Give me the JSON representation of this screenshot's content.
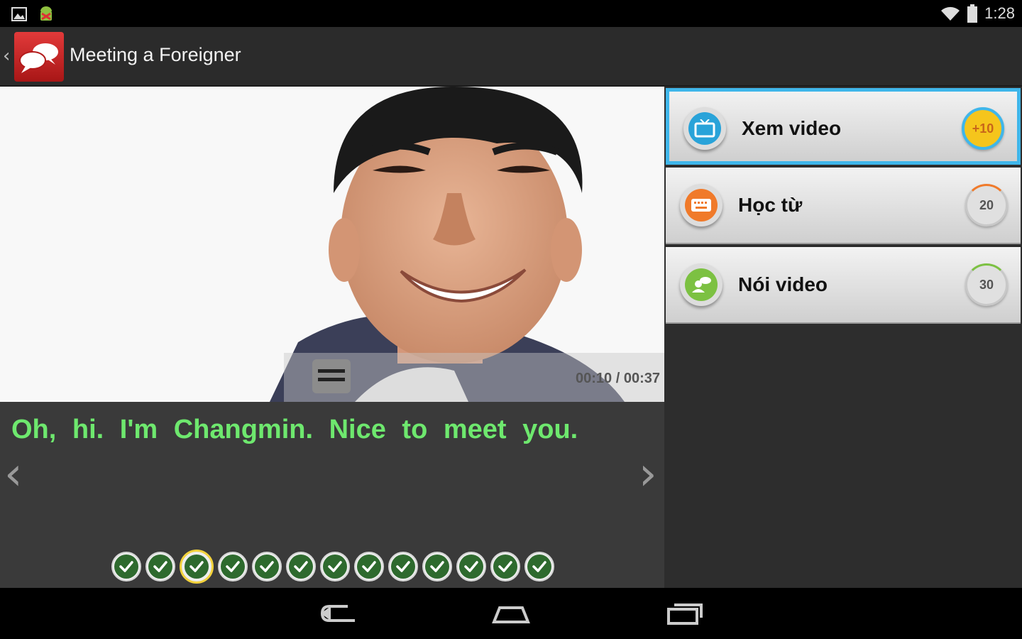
{
  "status_bar": {
    "time": "1:28",
    "icons": [
      "image-icon",
      "android-debug-icon",
      "wifi-icon",
      "battery-icon"
    ]
  },
  "action_bar": {
    "title": "Meeting a Foreigner",
    "logo": "chat-bubbles-logo"
  },
  "video": {
    "time_display": "00:10 / 00:37"
  },
  "subtitle": {
    "text": "Oh, hi. I'm Changmin. Nice to meet you."
  },
  "progress": {
    "total_dots": 13,
    "active_index": 2
  },
  "menu": {
    "items": [
      {
        "label": "Xem video",
        "badge": "+10",
        "icon": "tv-icon",
        "selected": true
      },
      {
        "label": "Học từ",
        "badge": "20",
        "icon": "keyboard-icon",
        "selected": false
      },
      {
        "label": "Nói video",
        "badge": "30",
        "icon": "people-chat-icon",
        "selected": false
      }
    ]
  },
  "colors": {
    "subtitle_green": "#6ee86e",
    "selected_border": "#3fb6ea",
    "badge_gold": "#f5c51c"
  }
}
